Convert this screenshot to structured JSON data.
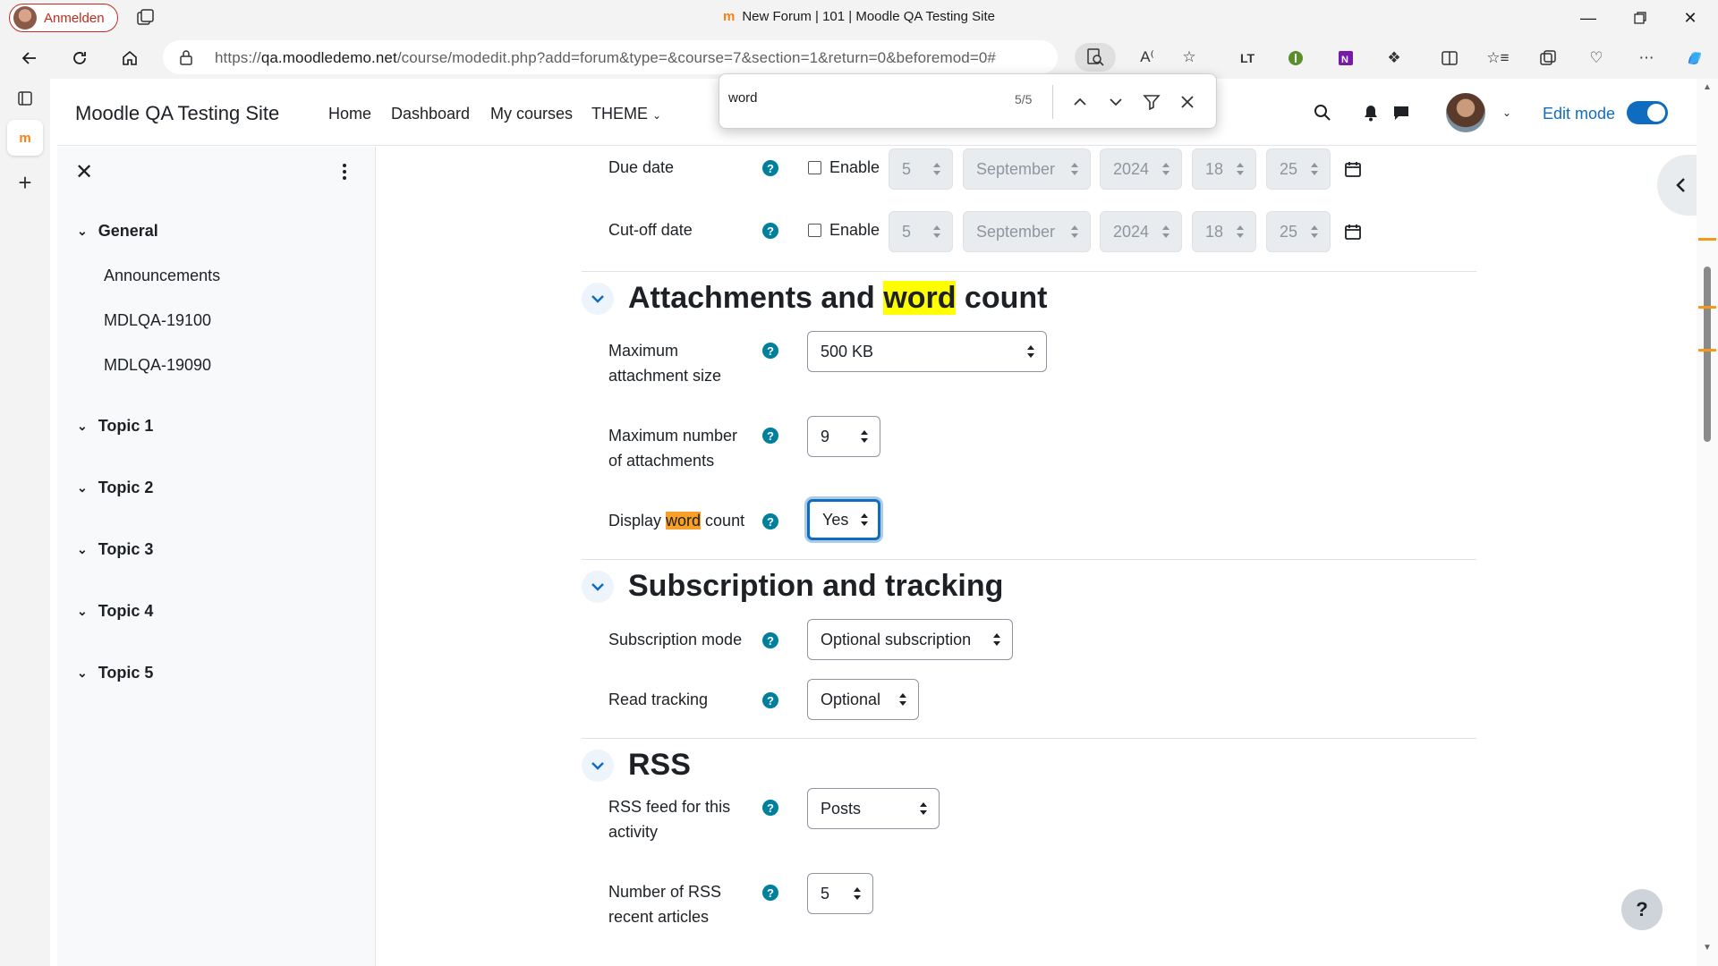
{
  "browser": {
    "profile_label": "Anmelden",
    "tab_title": "New Forum | 101 | Moodle QA Testing Site",
    "url_prefix": "https://",
    "url_host": "qa.moodledemo.net",
    "url_path": "/course/modedit.php?add=forum&type=&course=7&section=1&return=0&beforemod=0#"
  },
  "find": {
    "query": "word",
    "count": "5/5"
  },
  "navbar": {
    "site_name": "Moodle QA Testing Site",
    "links": [
      "Home",
      "Dashboard",
      "My courses",
      "THEME"
    ],
    "edit_mode_label": "Edit mode",
    "edit_mode_on": true
  },
  "course_index": {
    "sections": [
      {
        "title": "General",
        "activities": [
          "Announcements",
          "MDLQA-19100",
          "MDLQA-19090"
        ]
      },
      {
        "title": "Topic 1",
        "activities": []
      },
      {
        "title": "Topic 2",
        "activities": []
      },
      {
        "title": "Topic 3",
        "activities": []
      },
      {
        "title": "Topic 4",
        "activities": []
      },
      {
        "title": "Topic 5",
        "activities": []
      }
    ]
  },
  "form": {
    "due_date": {
      "label": "Due date",
      "enable_label": "Enable",
      "enabled": false,
      "day": "5",
      "month": "September",
      "year": "2024",
      "hour": "18",
      "minute": "25"
    },
    "cutoff_date": {
      "label": "Cut-off date",
      "enable_label": "Enable",
      "enabled": false,
      "day": "5",
      "month": "September",
      "year": "2024",
      "hour": "18",
      "minute": "25"
    },
    "attachments_section": {
      "title_before": "Attachments and ",
      "title_match": "word",
      "title_after": " count",
      "max_attachment_size_label": "Maximum attachment size",
      "max_attachment_size_line1": "Maximum",
      "max_attachment_size_line2": "attachment size",
      "max_attachment_size_value": "500 KB",
      "max_attachments_line1": "Maximum number",
      "max_attachments_line2": "of attachments",
      "max_attachments_value": "9",
      "display_wordcount_before": "Display ",
      "display_wordcount_match": "word",
      "display_wordcount_after": " count",
      "display_wordcount_value": "Yes"
    },
    "subscription_section": {
      "title": "Subscription and tracking",
      "subscription_mode_label": "Subscription mode",
      "subscription_mode_value": "Optional subscription",
      "read_tracking_label": "Read tracking",
      "read_tracking_value": "Optional"
    },
    "rss_section": {
      "title": "RSS",
      "rss_feed_line1": "RSS feed for this",
      "rss_feed_line2": "activity",
      "rss_feed_value": "Posts",
      "rss_articles_line1": "Number of RSS",
      "rss_articles_line2": "recent articles",
      "rss_articles_value": "5"
    }
  },
  "help_fab_label": "?",
  "colors": {
    "accent": "#0f6cbf",
    "help_icon": "#00809d",
    "find_highlight": "#ffff00",
    "find_active_highlight": "#f79f28"
  }
}
